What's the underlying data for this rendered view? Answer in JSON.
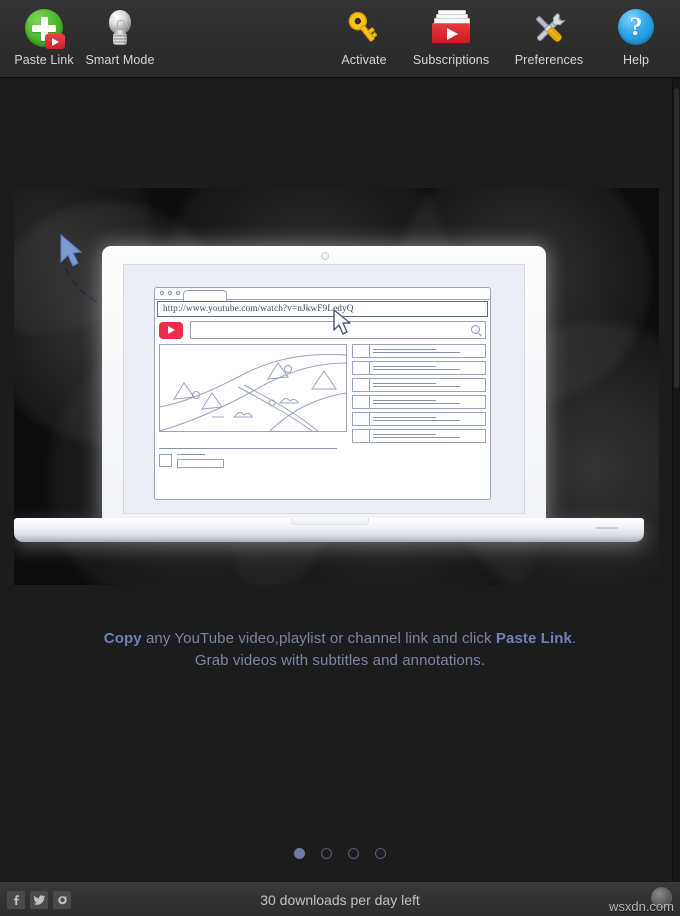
{
  "toolbar": {
    "left_items": [
      {
        "label": "Paste Link",
        "icon": "paste-link-icon"
      },
      {
        "label": "Smart Mode",
        "icon": "lightbulb-icon"
      }
    ],
    "right_items": [
      {
        "label": "Activate",
        "icon": "key-icon"
      },
      {
        "label": "Subscriptions",
        "icon": "subscriptions-box-icon"
      },
      {
        "label": "Preferences",
        "icon": "tools-icon"
      },
      {
        "label": "Help",
        "icon": "question-mark-icon"
      }
    ]
  },
  "hero": {
    "browser": {
      "url": "http://www.youtube.com/watch?v=nJkwF9LedyQ",
      "search_placeholder": "",
      "logo": "youtube-logo-icon",
      "search_icon": "magnifier-icon",
      "window_dots": 3,
      "suggestion_count": 6
    },
    "cursor_icon": "arrow-cursor-icon",
    "pointer_icon": "mouse-pointer-icon"
  },
  "caption": {
    "line1_part1": "Copy",
    "line1_part2": " any YouTube video,playlist or channel link and click ",
    "line1_part3": "Paste Link",
    "line1_part4": ".",
    "line2": "Grab videos with subtitles and annotations."
  },
  "pager": {
    "total": 4,
    "active_index": 0
  },
  "statusbar": {
    "social": [
      {
        "name": "facebook-icon",
        "glyph": "f"
      },
      {
        "name": "twitter-icon",
        "glyph": "ᴠ"
      },
      {
        "name": "instagram-icon",
        "glyph": "◉"
      }
    ],
    "downloads_text": "30 downloads per day left",
    "watermark": "wsxdn.com",
    "account_icon": "globe-avatar-icon"
  },
  "colors": {
    "toolbar_bg": "#2e2e2e",
    "stage_bg": "#1c1c1c",
    "caption_text": "#7c86a5",
    "caption_accent": "#6f82bb",
    "active_dot": "#6d7ca6",
    "youtube_red": "#ef2b49",
    "paste_green": "#4fb82e",
    "help_blue": "#2fa7e8"
  }
}
